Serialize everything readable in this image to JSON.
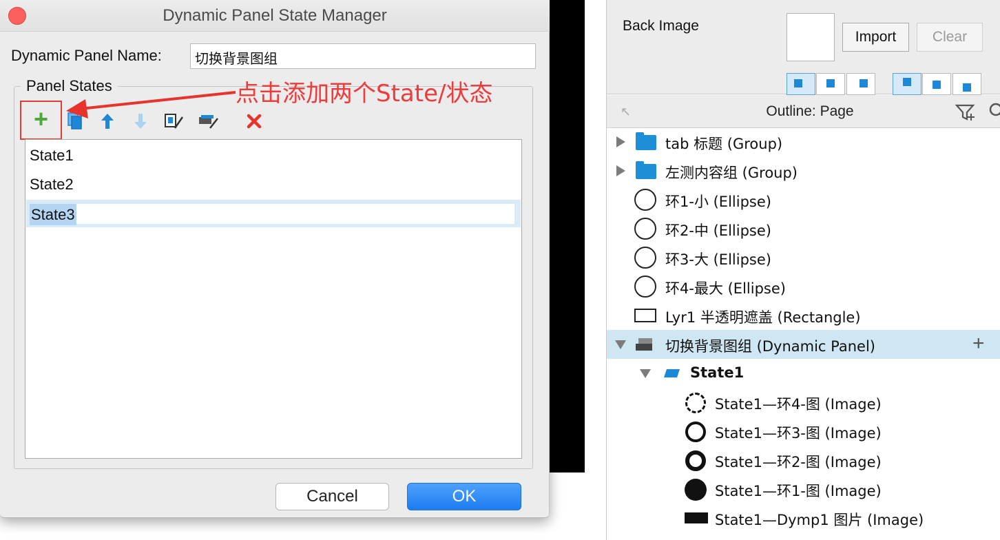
{
  "dialog": {
    "title": "Dynamic Panel State Manager",
    "name_label": "Dynamic Panel Name:",
    "name_value": "切换背景图组",
    "states_legend": "Panel States",
    "annotation": "点击添加两个State/状态",
    "states": [
      "State1",
      "State2",
      "State3"
    ],
    "selected_state": "State3",
    "cancel_label": "Cancel",
    "ok_label": "OK",
    "toolbar_icons": [
      "add-state-icon",
      "duplicate-state-icon",
      "move-up-icon",
      "move-down-icon",
      "edit-state-icon",
      "edit-all-states-icon",
      "delete-state-icon"
    ]
  },
  "style_panel": {
    "back_image_label": "Back Image",
    "import_label": "Import",
    "clear_label": "Clear"
  },
  "outline": {
    "title": "Outline: Page",
    "items": [
      {
        "label": "tab 标题 (Group)",
        "icon": "folder-icon"
      },
      {
        "label": "左测内容组 (Group)",
        "icon": "folder-icon"
      },
      {
        "label": "环1-小 (Ellipse)",
        "icon": "ellipse-icon"
      },
      {
        "label": "环2-中 (Ellipse)",
        "icon": "ellipse-icon"
      },
      {
        "label": "环3-大 (Ellipse)",
        "icon": "ellipse-icon"
      },
      {
        "label": "环4-最大 (Ellipse)",
        "icon": "ellipse-icon"
      },
      {
        "label": "Lyr1 半透明遮盖 (Rectangle)",
        "icon": "rectangle-icon"
      },
      {
        "label": "切换背景图组 (Dynamic Panel)",
        "icon": "dynamic-panel-icon"
      },
      {
        "label": "State1",
        "icon": "state-icon"
      },
      {
        "label": "State1—环4-图 (Image)",
        "icon": "image-thumb-icon"
      },
      {
        "label": "State1—环3-图 (Image)",
        "icon": "image-thumb-icon"
      },
      {
        "label": "State1—环2-图 (Image)",
        "icon": "image-thumb-icon"
      },
      {
        "label": "State1—环1-图 (Image)",
        "icon": "image-thumb-icon"
      },
      {
        "label": "State1—Dymp1 图片 (Image)",
        "icon": "image-thumb-icon"
      }
    ]
  },
  "colors": {
    "accent_blue": "#1e88d8",
    "annotation_red": "#ee3b3b",
    "add_green": "#4fa83a",
    "selection_blue": "#cfe6f3"
  }
}
